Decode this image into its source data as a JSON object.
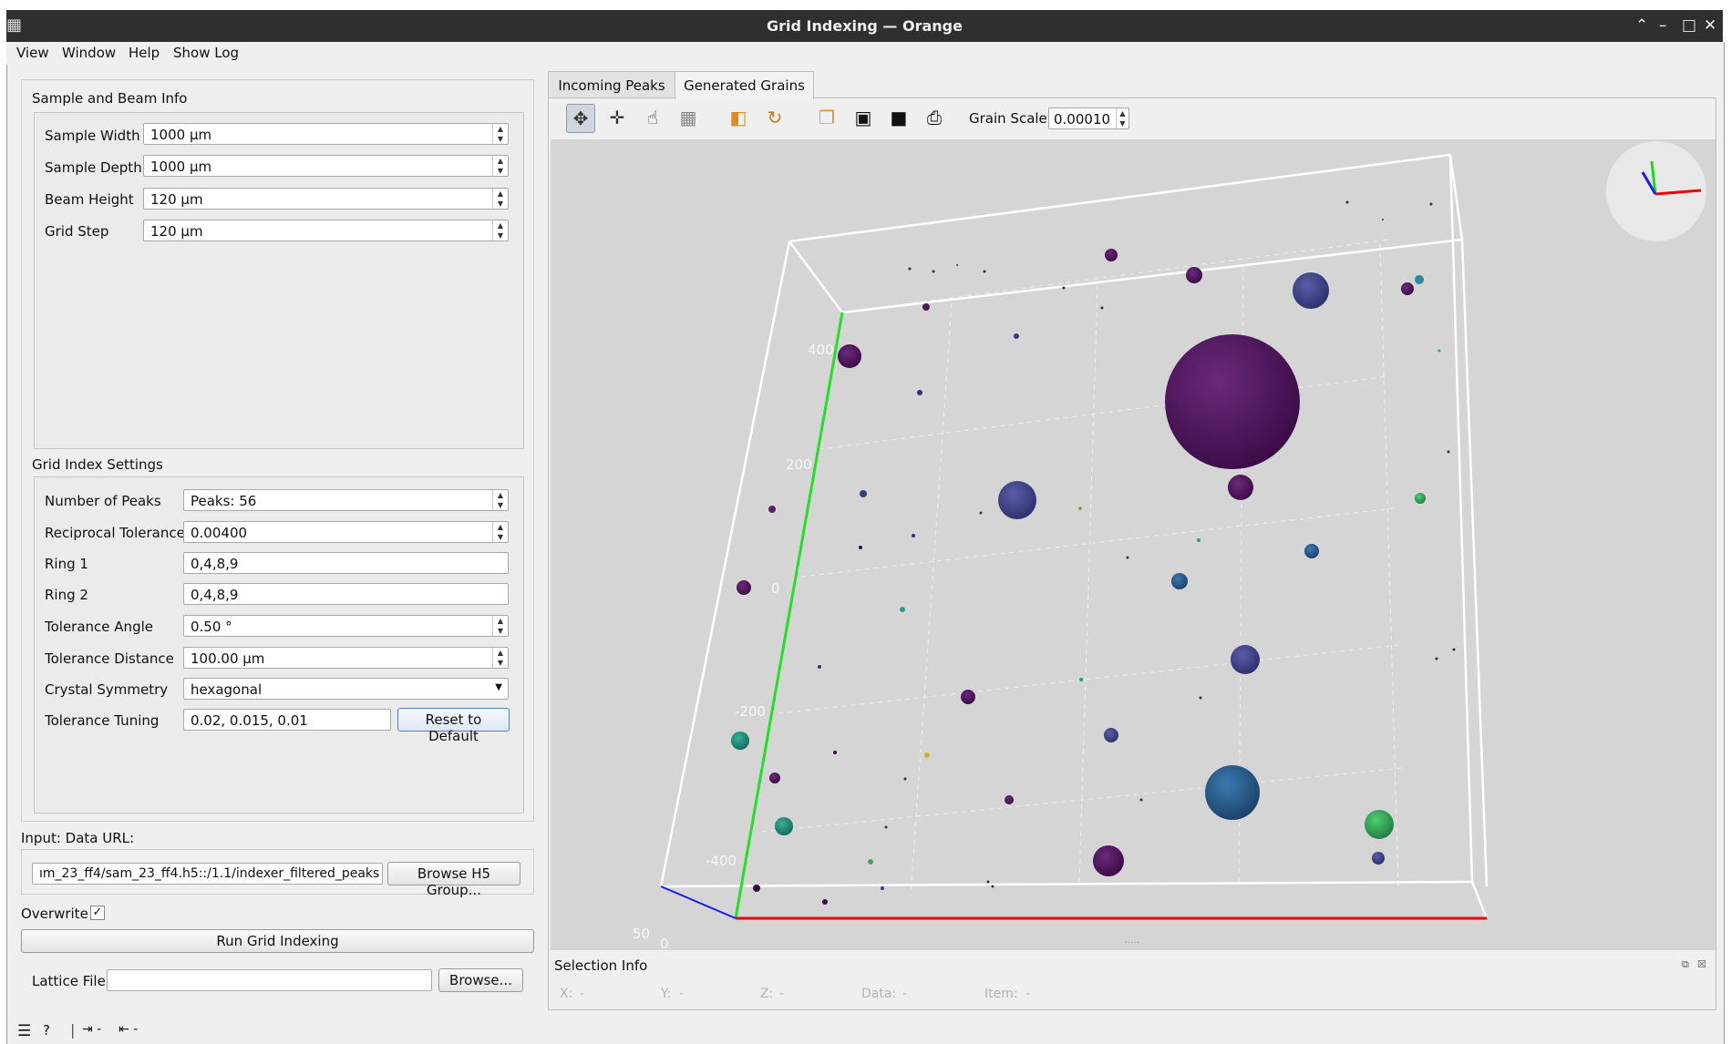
{
  "window": {
    "title": "Grid Indexing — Orange"
  },
  "menubar": [
    "View",
    "Window",
    "Help",
    "Show Log"
  ],
  "sample_beam": {
    "title": "Sample and Beam Info",
    "rows": [
      {
        "label": "Sample Width",
        "value": "1000 µm"
      },
      {
        "label": "Sample Depth",
        "value": "1000 µm"
      },
      {
        "label": "Beam Height",
        "value": "120 µm"
      },
      {
        "label": "Grid Step",
        "value": "120 µm"
      }
    ]
  },
  "grid_index": {
    "title": "Grid Index Settings",
    "number_of_peaks": {
      "label": "Number of Peaks",
      "value": "Peaks: 56"
    },
    "reciprocal_tolerance": {
      "label": "Reciprocal Tolerance",
      "value": "0.00400"
    },
    "ring1": {
      "label": "Ring 1",
      "value": "0,4,8,9"
    },
    "ring2": {
      "label": "Ring 2",
      "value": "0,4,8,9"
    },
    "tolerance_angle": {
      "label": "Tolerance Angle",
      "value": "0.50 °"
    },
    "tolerance_distance": {
      "label": "Tolerance Distance",
      "value": "100.00 µm"
    },
    "crystal_symmetry": {
      "label": "Crystal Symmetry",
      "value": "hexagonal"
    },
    "tolerance_tuning": {
      "label": "Tolerance Tuning",
      "value": "0.02, 0.015, 0.01"
    },
    "reset_label": "Reset to Default"
  },
  "input": {
    "label": "Input: Data URL:",
    "url": "ım_23_ff4/sam_23_ff4.h5::/1.1/indexer_filtered_peaks",
    "browse_h5_label": "Browse H5 Group..."
  },
  "overwrite": {
    "label": "Overwrite",
    "checked": "✓"
  },
  "run_label": "Run Grid Indexing",
  "lattice": {
    "label": "Lattice File",
    "value": "",
    "browse_label": "Browse..."
  },
  "tabs": [
    "Incoming Peaks",
    "Generated Grains"
  ],
  "active_tab": "Generated Grains",
  "toolbar": {
    "icons": [
      "rotate-icon",
      "pan-icon",
      "hand-icon",
      "plane-icon",
      "cube-icon",
      "revolve-icon",
      "copy-icon",
      "save-icon",
      "camera-icon",
      "print-icon"
    ],
    "grain_scale_label": "Grain Scale:",
    "grain_scale_value": "0.00010"
  },
  "plot": {
    "axis_ticks": [
      "400",
      "200",
      "0",
      "-200",
      "-400",
      "50",
      "0"
    ],
    "axis_colors": {
      "x": "#ff0000",
      "y": "#00e000",
      "z": "#0000ff"
    },
    "background": "#d5d5d5"
  },
  "selection_info": {
    "title": "Selection Info",
    "fields": [
      "X:",
      "-",
      "Y:",
      "-",
      "Z:",
      "-",
      "Data:",
      "-",
      "Item:",
      "-"
    ]
  }
}
